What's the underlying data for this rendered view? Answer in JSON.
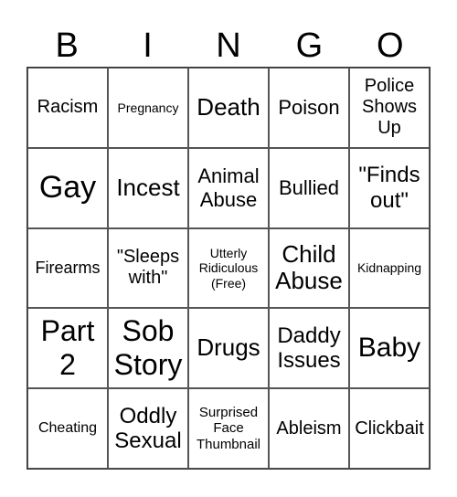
{
  "header": {
    "letters": [
      "B",
      "I",
      "N",
      "G",
      "O"
    ]
  },
  "cells": [
    [
      "Racism",
      "Pregnancy",
      "Death",
      "Poison",
      "Police Shows Up"
    ],
    [
      "Gay",
      "Incest",
      "Animal Abuse",
      "Bullied",
      "\"Finds out\""
    ],
    [
      "Firearms",
      "\"Sleeps with\"",
      "Utterly Ridiculous (Free)",
      "Child Abuse",
      "Kidnapping"
    ],
    [
      "Part 2",
      "Sob Story",
      "Drugs",
      "Daddy Issues",
      "Baby"
    ],
    [
      "Cheating",
      "Oddly Sexual",
      "Surprised Face Thumbnail",
      "Ableism",
      "Clickbait"
    ]
  ]
}
